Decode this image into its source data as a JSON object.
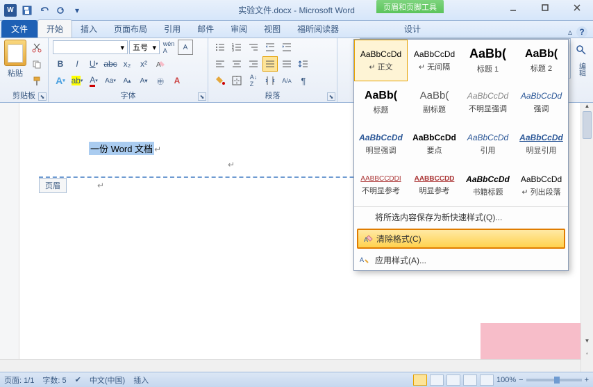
{
  "titlebar": {
    "filename": "实验文件.docx",
    "app_name": "Microsoft Word",
    "title_combined": "实验文件.docx - Microsoft Word",
    "context_tool": "页眉和页脚工具"
  },
  "tabs": {
    "file": "文件",
    "items": [
      "开始",
      "插入",
      "页面布局",
      "引用",
      "邮件",
      "审阅",
      "视图",
      "福昕阅读器"
    ],
    "context": "设计"
  },
  "ribbon": {
    "clipboard": {
      "label": "剪贴板",
      "paste": "粘贴"
    },
    "font": {
      "label": "字体",
      "name": "",
      "size": "五号"
    },
    "paragraph": {
      "label": "段落"
    }
  },
  "styles_gallery": [
    {
      "preview": "AaBbCcDd",
      "name": "↵ 正文",
      "preview_style": "font-size:12px"
    },
    {
      "preview": "AaBbCcDd",
      "name": "↵ 无间隔",
      "preview_style": "font-size:12px"
    },
    {
      "preview": "AaBb",
      "name": "标题 1",
      "preview_style": "font-size:20px;font-weight:bold"
    },
    {
      "preview": "AaBb",
      "name": "标题 2",
      "preview_style": "font-size:18px;font-weight:bold"
    }
  ],
  "style_panel": {
    "rows": [
      [
        {
          "preview": "AaBbCcDd",
          "name": "↵ 正文",
          "sel": true,
          "style": ""
        },
        {
          "preview": "AaBbCcDd",
          "name": "↵ 无间隔",
          "style": ""
        },
        {
          "preview": "AaBb(",
          "name": "标题 1",
          "style": "font-size:18px;font-weight:bold"
        },
        {
          "preview": "AaBb(",
          "name": "标题 2",
          "style": "font-size:16px;font-weight:bold"
        }
      ],
      [
        {
          "preview": "AaBb(",
          "name": "标题",
          "style": "font-size:16px;font-weight:bold"
        },
        {
          "preview": "AaBb(",
          "name": "副标题",
          "style": "font-size:15px;color:#555"
        },
        {
          "preview": "AaBbCcDd",
          "name": "不明显强调",
          "style": "font-style:italic;color:#888"
        },
        {
          "preview": "AaBbCcDd",
          "name": "强调",
          "style": "font-style:italic;color:#2b5797"
        }
      ],
      [
        {
          "preview": "AaBbCcDd",
          "name": "明显强调",
          "style": "font-style:italic;font-weight:bold;color:#2b5797"
        },
        {
          "preview": "AaBbCcDd",
          "name": "要点",
          "style": "font-weight:bold"
        },
        {
          "preview": "AaBbCcDd",
          "name": "引用",
          "style": "font-style:italic;color:#2b5797"
        },
        {
          "preview": "AaBbCcDd",
          "name": "明显引用",
          "style": "font-style:italic;font-weight:bold;color:#2b5797;text-decoration:underline"
        }
      ],
      [
        {
          "preview": "AABBCCDDI",
          "name": "不明显参考",
          "style": "font-size:10px;color:#a33;text-decoration:underline"
        },
        {
          "preview": "AABBCCDD",
          "name": "明显参考",
          "style": "font-size:10px;font-weight:bold;color:#a33;text-decoration:underline"
        },
        {
          "preview": "AaBbCcDd",
          "name": "书籍标题",
          "style": "font-style:italic;font-weight:bold"
        },
        {
          "preview": "AaBbCcDd",
          "name": "↵ 列出段落",
          "style": ""
        }
      ]
    ],
    "save_as_quick": "将所选内容保存为新快速样式(Q)...",
    "clear_format": "清除格式(C)",
    "apply_style": "应用样式(A)..."
  },
  "document": {
    "header_text": "一份 Word 文档",
    "header_tag": "页眉"
  },
  "statusbar": {
    "page": "页面: 1/1",
    "words": "字数: 5",
    "language": "中文(中国)",
    "mode": "插入",
    "zoom": "100%"
  }
}
